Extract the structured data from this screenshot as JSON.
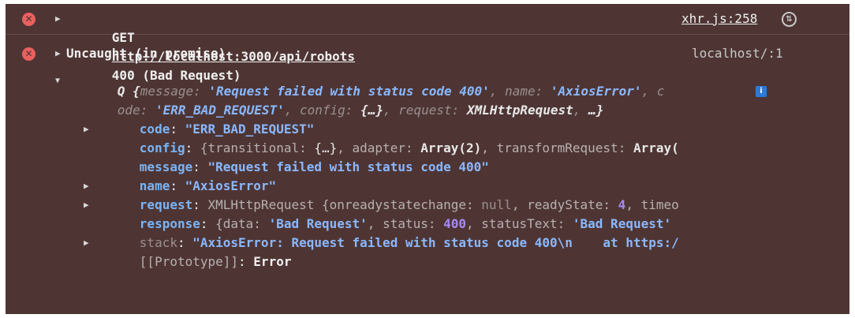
{
  "entry1": {
    "method": "GET",
    "url": "http://localhost:3000/api/robots",
    "status": "400 (Bad Request)",
    "source": "xhr.js:258"
  },
  "entry2": {
    "header": "Uncaught (in promise)",
    "source": "localhost/:1",
    "summary_line1": {
      "prefix": "Q {",
      "k1": "message",
      "v1": "'Request failed with status code 400'",
      "k2": "name",
      "v2": "'AxiosError'",
      "k3_part": "c"
    },
    "summary_line2": {
      "k3_rest": "ode",
      "v3": "'ERR_BAD_REQUEST'",
      "k4": "config",
      "v4": "{…}",
      "k5": "request",
      "v5": "XMLHttpRequest",
      "tail": "…}"
    },
    "info_badge": "i",
    "props": {
      "code": {
        "key": "code",
        "value": "\"ERR_BAD_REQUEST\""
      },
      "config": {
        "key": "config",
        "k1": "transitional",
        "v1": "{…}",
        "k2": "adapter",
        "v2": "Array(2)",
        "k3": "transformRequest",
        "v3": "Array("
      },
      "message": {
        "key": "message",
        "value": "\"Request failed with status code 400\""
      },
      "name": {
        "key": "name",
        "value": "\"AxiosError\""
      },
      "request": {
        "key": "request",
        "type": "XMLHttpRequest",
        "k1": "onreadystatechange",
        "v1": "null",
        "k2": "readyState",
        "v2": "4",
        "k3": "timeo"
      },
      "response": {
        "key": "response",
        "k1": "data",
        "v1": "'Bad Request'",
        "k2": "status",
        "v2": "400",
        "k3": "statusText",
        "v3": "'Bad Request'"
      },
      "stack": {
        "key": "stack",
        "value": "\"AxiosError: Request failed with status code 400\\n    at https:/"
      },
      "prototype": {
        "key": "[[Prototype]]",
        "value": "Error"
      }
    }
  }
}
